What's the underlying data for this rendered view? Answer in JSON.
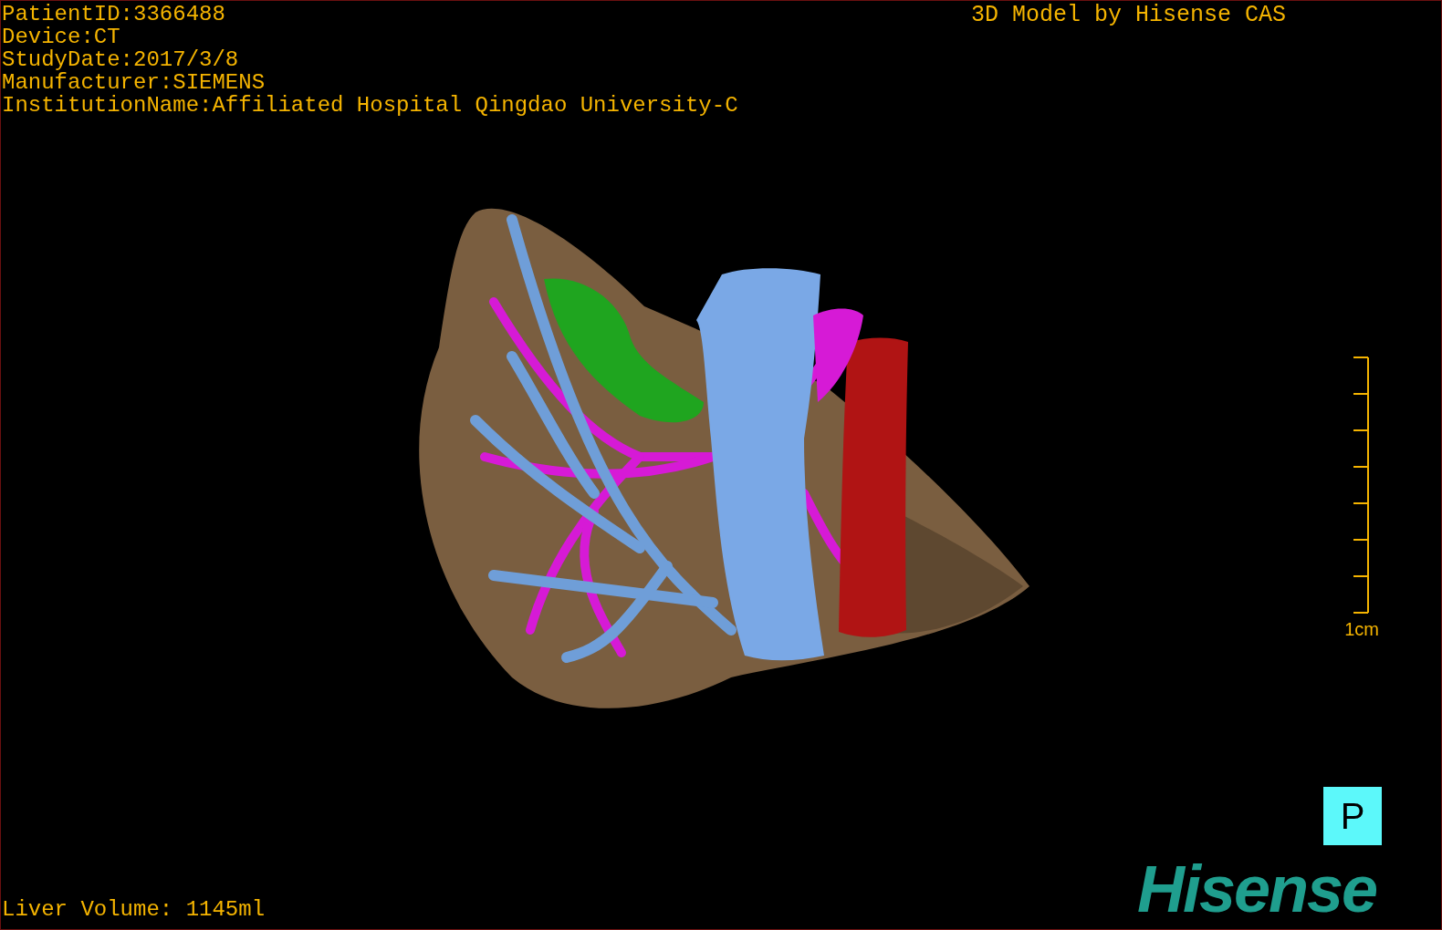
{
  "patient_info": [
    "PatientID:3366488",
    "Device:CT",
    "StudyDate:2017/3/8",
    "Manufacturer:SIEMENS",
    "InstitutionName:Affiliated Hospital Qingdao University-C"
  ],
  "title": "3D Model by Hisense CAS",
  "scale_bar": {
    "label": "1cm"
  },
  "orientation_marker": "P",
  "liver_volume": "Liver Volume: 1145ml",
  "logo": "Hisense"
}
